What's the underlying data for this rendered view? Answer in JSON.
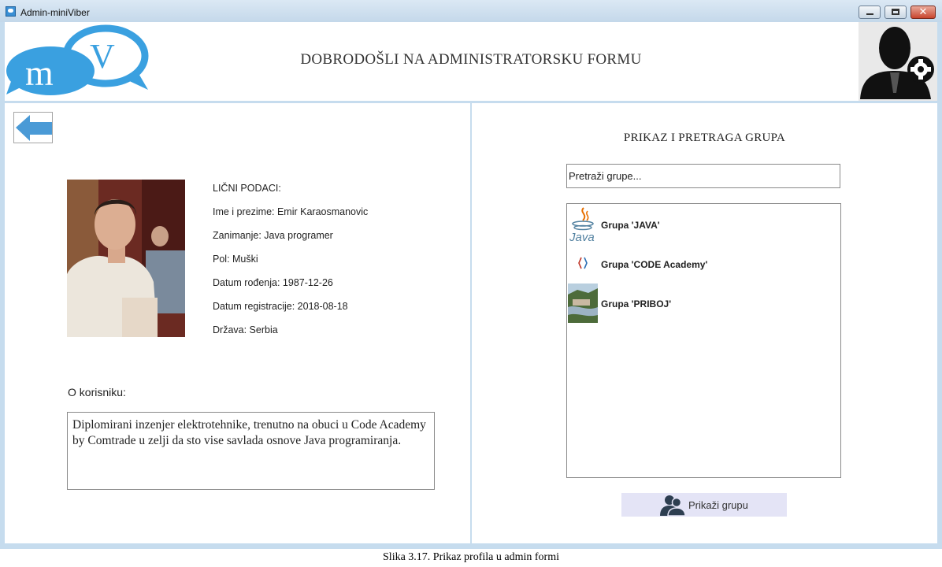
{
  "window": {
    "title": "Admin-miniViber",
    "min_label": "",
    "max_label": "",
    "close_label": "✕"
  },
  "header": {
    "logo_text": "mV",
    "title": "DOBRODOŠLI NA ADMINISTRATORSKU FORMU"
  },
  "profile": {
    "section_label": "LIČNI PODACI:",
    "fields": [
      "Ime i prezime: Emir Karaosmanovic",
      "Zanimanje: Java programer",
      "Pol: Muški",
      "Datum rođenja: 1987-12-26",
      "Datum registracije: 2018-08-18",
      "Država: Serbia"
    ],
    "about_label": "O korisniku:",
    "about_text": "Diplomirani inzenjer elektrotehnike, trenutno na obuci u Code Academy by Comtrade u zelji da sto vise savlada osnove Java programiranja."
  },
  "groups": {
    "title": "PRIKAZ I PRETRAGA GRUPA",
    "search_placeholder": "Pretraži grupe...",
    "items": [
      {
        "label": "Grupa 'JAVA'",
        "icon": "java-logo-icon"
      },
      {
        "label": "Grupa 'CODE Academy'",
        "icon": "code-academy-icon"
      },
      {
        "label": "Grupa 'PRIBOJ'",
        "icon": "priboj-photo-icon"
      }
    ],
    "show_button": "Prikaži grupu"
  },
  "colors": {
    "accent": "#3a8fd4",
    "frame": "#c6dcee",
    "button_bg": "#e4e4f6"
  },
  "caption": "Slika 3.17. Prikaz profila u admin formi"
}
